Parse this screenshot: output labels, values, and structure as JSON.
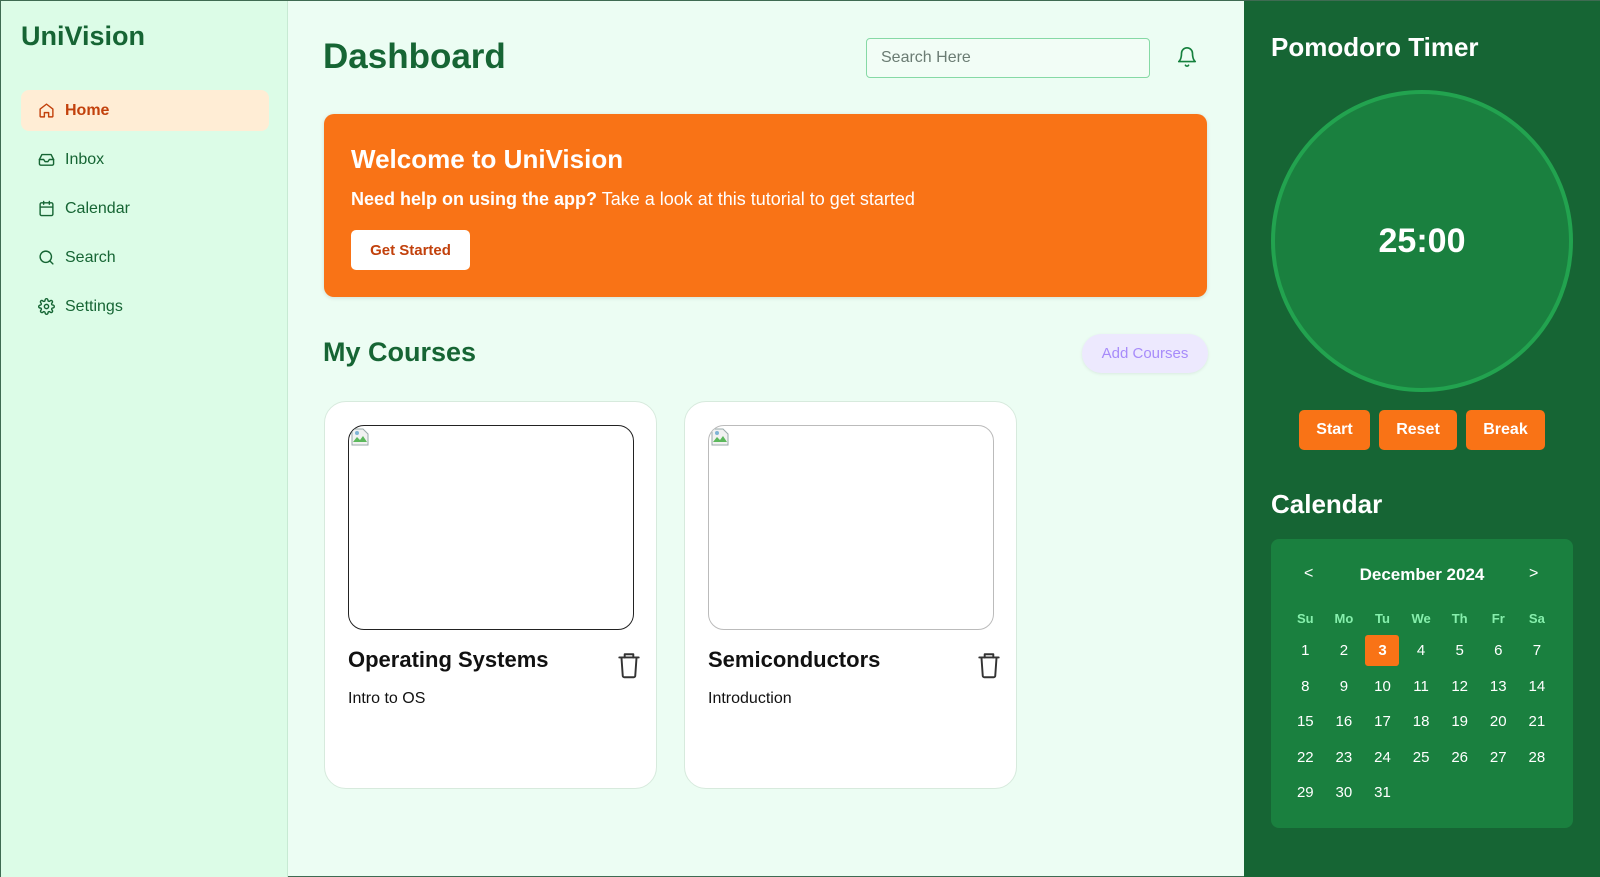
{
  "app": {
    "name": "UniVision"
  },
  "sidebar": {
    "items": [
      {
        "label": "Home",
        "icon": "home-icon",
        "active": true
      },
      {
        "label": "Inbox",
        "icon": "inbox-icon",
        "active": false
      },
      {
        "label": "Calendar",
        "icon": "calendar-icon",
        "active": false
      },
      {
        "label": "Search",
        "icon": "search-icon",
        "active": false
      },
      {
        "label": "Settings",
        "icon": "gear-icon",
        "active": false
      }
    ]
  },
  "header": {
    "title": "Dashboard",
    "search_placeholder": "Search Here"
  },
  "welcome": {
    "title": "Welcome to UniVision",
    "help_bold": "Need help on using the app?",
    "help_text": " Take a look at this tutorial to get started",
    "button": "Get Started"
  },
  "courses": {
    "title": "My Courses",
    "add_button": "Add Courses",
    "items": [
      {
        "title": "Operating Systems",
        "subtitle": "Intro to OS"
      },
      {
        "title": "Semiconductors",
        "subtitle": "Introduction"
      }
    ]
  },
  "pomodoro": {
    "title": "Pomodoro Timer",
    "time": "25:00",
    "buttons": {
      "start": "Start",
      "reset": "Reset",
      "break": "Break"
    }
  },
  "calendar": {
    "title": "Calendar",
    "month": "December 2024",
    "prev": "<",
    "next": ">",
    "weekdays": [
      "Su",
      "Mo",
      "Tu",
      "We",
      "Th",
      "Fr",
      "Sa"
    ],
    "first_weekday_index": 0,
    "days_in_month": 31,
    "today": 3
  },
  "colors": {
    "primary_green": "#166534",
    "accent_orange": "#f97316",
    "sidebar_bg": "#dcfce7",
    "main_bg": "#ecfdf3"
  }
}
